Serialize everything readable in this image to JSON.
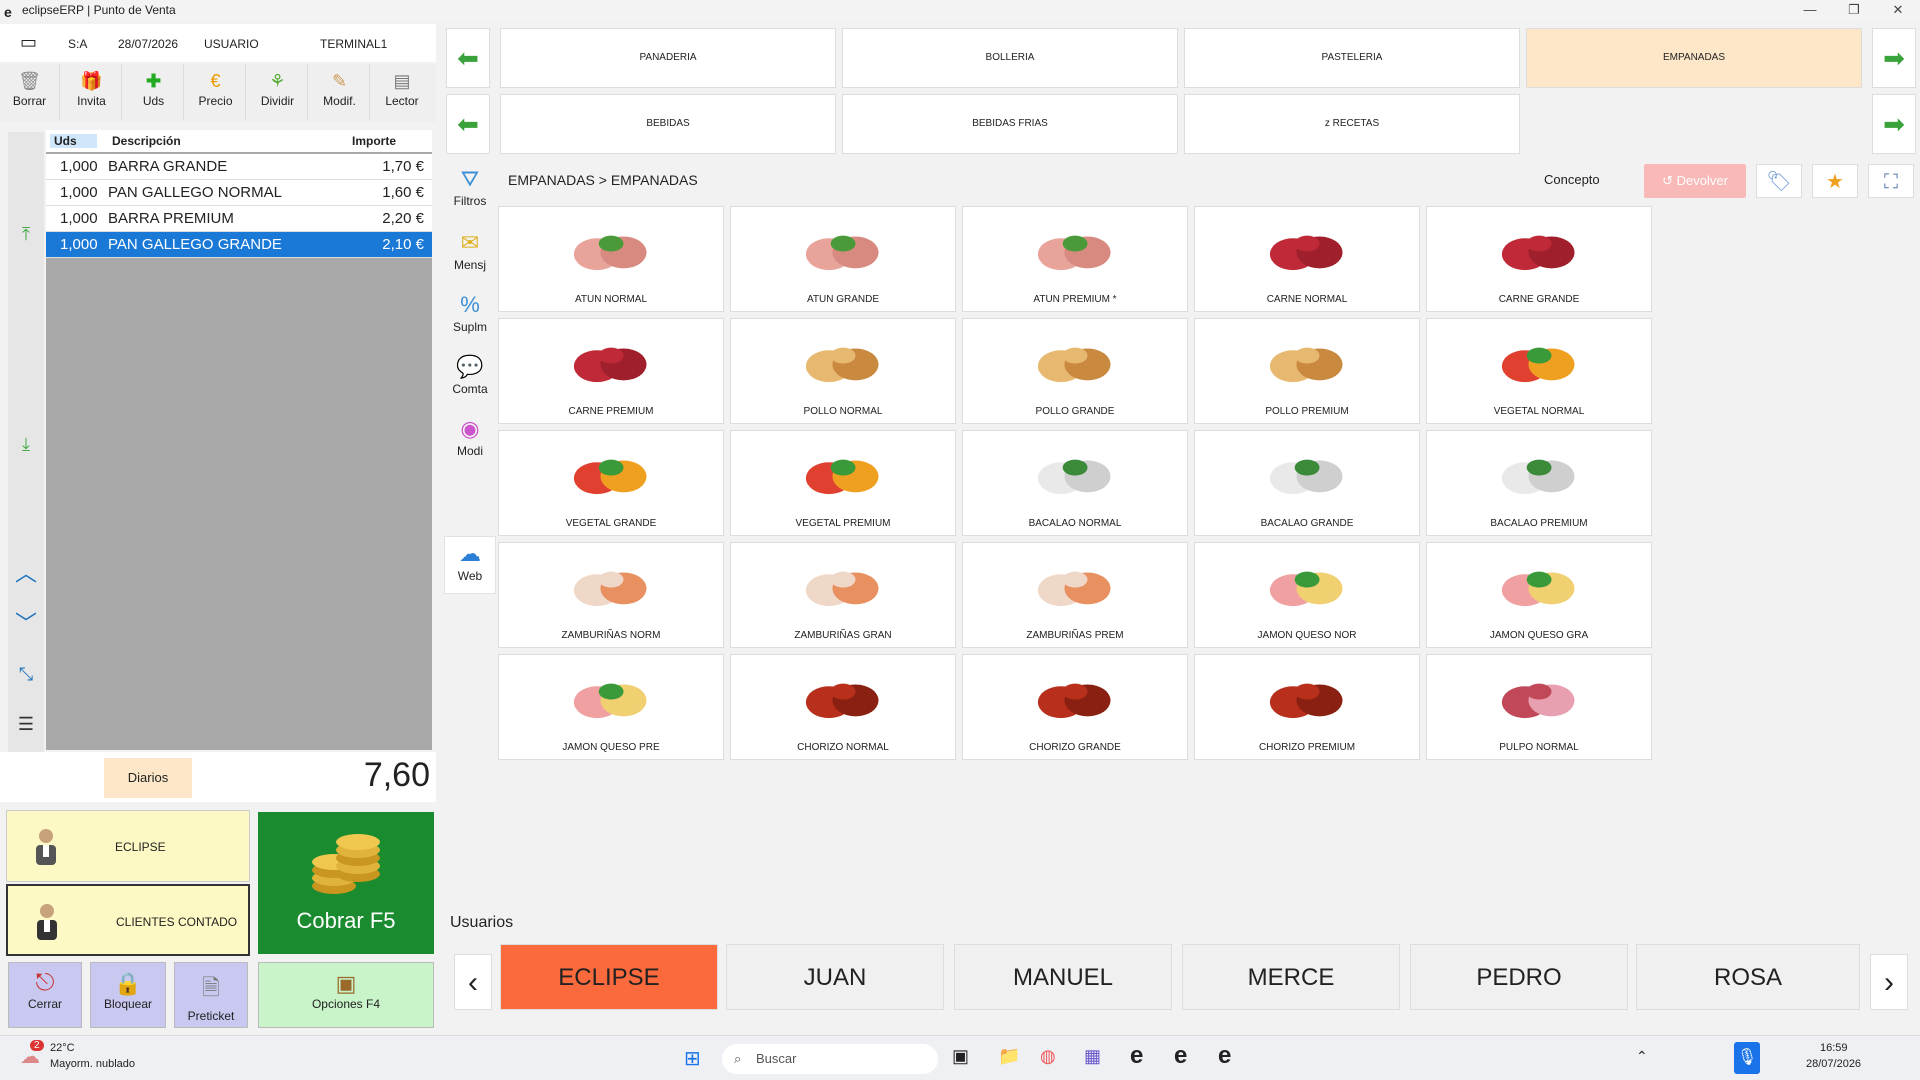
{
  "window": {
    "title": "eclipseERP | Punto de Venta"
  },
  "header": {
    "series": "S:A",
    "date": "28/07/2026",
    "user": "USUARIO",
    "terminal": "TERMINAL1"
  },
  "toolbar": [
    "Borrar",
    "Invita",
    "Uds",
    "Precio",
    "Dividir",
    "Modif.",
    "Lector"
  ],
  "order": {
    "columns": [
      "Uds",
      "Descripción",
      "Importe"
    ],
    "rows": [
      {
        "uds": "1,000",
        "desc": "BARRA GRANDE",
        "imp": "1,70 €"
      },
      {
        "uds": "1,000",
        "desc": "PAN GALLEGO NORMAL",
        "imp": "1,60 €"
      },
      {
        "uds": "1,000",
        "desc": "BARRA PREMIUM",
        "imp": "2,20 €"
      },
      {
        "uds": "1,000",
        "desc": "PAN GALLEGO GRANDE",
        "imp": "2,10 €"
      }
    ]
  },
  "totals": {
    "diarios": "Diarios",
    "total": "7,60"
  },
  "customers": {
    "eclipse": "ECLIPSE",
    "contado": "CLIENTES CONTADO"
  },
  "cobrar": {
    "label": "Cobrar F5"
  },
  "bottom": {
    "cerrar": "Cerrar",
    "bloquear": "Bloquear",
    "preticket": "Preticket",
    "opciones": "Opciones F4"
  },
  "middle": [
    "Filtros",
    "Mensj",
    "Suplm",
    "Comta",
    "Modi",
    "Web"
  ],
  "categories": {
    "row1": [
      "PANADERIA",
      "BOLLERIA",
      "PASTELERIA",
      "EMPANADAS"
    ],
    "row2": [
      "BEBIDAS",
      "BEBIDAS FRIAS",
      "z RECETAS"
    ]
  },
  "breadcrumb": "EMPANADAS > EMPANADAS",
  "concepto": "Concepto",
  "devolver": "Devolver",
  "products": [
    [
      "ATUN NORMAL",
      "ATUN GRANDE",
      "ATUN PREMIUM *",
      "CARNE NORMAL",
      "CARNE GRANDE"
    ],
    [
      "CARNE PREMIUM",
      "POLLO NORMAL",
      "POLLO GRANDE",
      "POLLO PREMIUM",
      "VEGETAL NORMAL"
    ],
    [
      "VEGETAL GRANDE",
      "VEGETAL PREMIUM",
      "BACALAO NORMAL",
      "BACALAO GRANDE",
      "BACALAO PREMIUM"
    ],
    [
      "ZAMBURIÑAS NORM",
      "ZAMBURIÑAS GRAN",
      "ZAMBURIÑAS PREM",
      "JAMON QUESO NOR",
      "JAMON QUESO GRA"
    ],
    [
      "JAMON QUESO PRE",
      "CHORIZO NORMAL",
      "CHORIZO GRANDE",
      "CHORIZO PREMIUM",
      "PULPO NORMAL"
    ]
  ],
  "usuarios": {
    "label": "Usuarios",
    "list": [
      "ECLIPSE",
      "JUAN",
      "MANUEL",
      "MERCE",
      "PEDRO",
      "ROSA"
    ]
  },
  "taskbar": {
    "temp": "22°C",
    "weather": "Mayorm. nublado",
    "search": "Buscar",
    "time": "16:59",
    "date": "28/07/2026",
    "badge": "2"
  }
}
